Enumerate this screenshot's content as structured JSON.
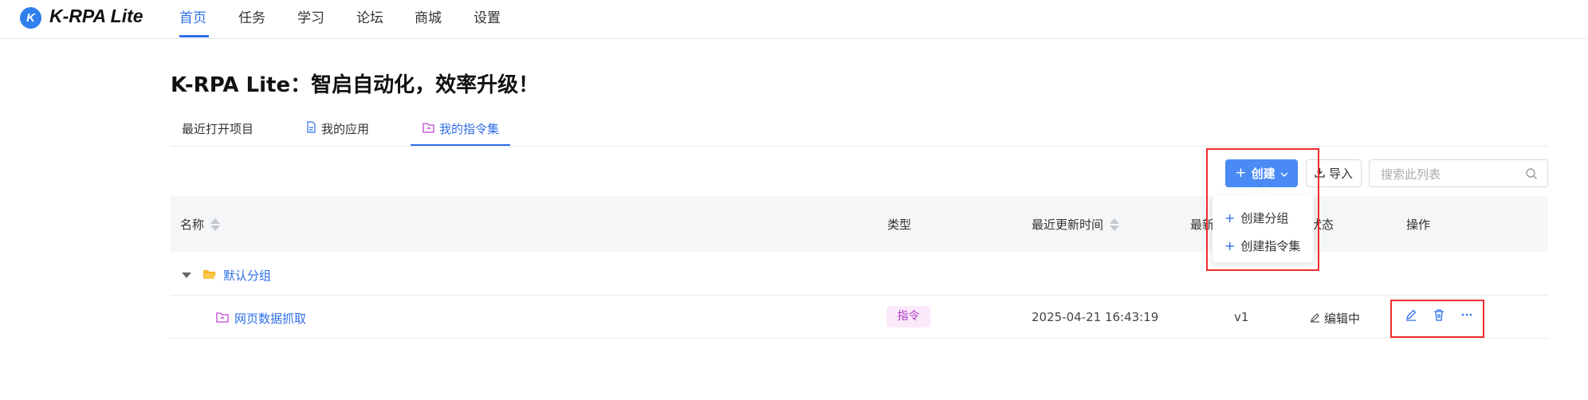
{
  "app": {
    "logo_letter": "K",
    "name": "K-RPA Lite"
  },
  "nav": [
    "首页",
    "任务",
    "学习",
    "论坛",
    "商城",
    "设置"
  ],
  "page_title": "K-RPA Lite：智启自动化，效率升级！",
  "tabs": [
    "最近打开项目",
    "我的应用",
    "我的指令集"
  ],
  "toolbar": {
    "create_label": "创建",
    "import_label": "导入",
    "search_placeholder": "搜索此列表"
  },
  "dropdown": [
    "创建分组",
    "创建指令集"
  ],
  "table": {
    "headers": {
      "name": "名称",
      "type": "类型",
      "updated": "最近更新时间",
      "version": "最新",
      "status": "状态",
      "actions": "操作"
    },
    "group": "默认分组",
    "row": {
      "name": "网页数据抓取",
      "type": "指令",
      "updated": "2025-04-21 16:43:19",
      "version": "v1",
      "status": "编辑中"
    }
  },
  "colors": {
    "accent": "#2f6fe8",
    "highlight": "#ef2c2c",
    "folder": "#f5b82e",
    "tag_text": "#b03cc4"
  }
}
